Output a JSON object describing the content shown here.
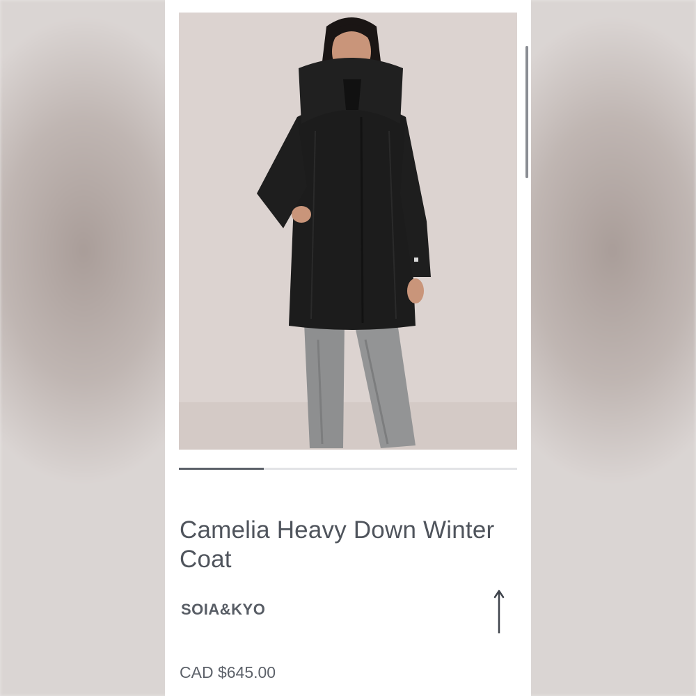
{
  "product": {
    "title": "Camelia Heavy Down Winter Coat",
    "brand": "SOIA&KYO",
    "price": "CAD $645.00",
    "image": {
      "subject": "model wearing long black hooded down coat with grey jeans"
    }
  },
  "gallery": {
    "progress_fraction": 0.25
  },
  "scroll_up_button": {
    "icon": "arrow-up-icon"
  },
  "colors": {
    "text": "#4f545c",
    "progress_track": "#e2e3e6",
    "progress_fill": "#5b6068",
    "photo_background": "#ddd4d1",
    "coat": "#1c1c1c",
    "jeans": "#8e8f90"
  }
}
